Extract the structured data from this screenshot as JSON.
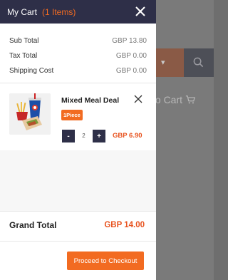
{
  "background": {
    "add_to_cart_label": "to Cart",
    "dropdown_glyph": "▾"
  },
  "cart": {
    "title": "My Cart",
    "item_count_label": "(1 Items)",
    "summary": {
      "sub_total_label": "Sub Total",
      "sub_total_value": "GBP 13.80",
      "tax_total_label": "Tax Total",
      "tax_total_value": "GBP 0.00",
      "shipping_label": "Shipping Cost",
      "shipping_value": "GBP 0.00"
    },
    "items": [
      {
        "name": "Mixed Meal Deal",
        "badge": "1Piece",
        "quantity": "2",
        "minus_label": "-",
        "plus_label": "+",
        "price": "GBP 6.90"
      }
    ],
    "grand_total_label": "Grand Total",
    "grand_total_value": "GBP 14.00",
    "checkout_label": "Proceed to Checkout"
  },
  "colors": {
    "header_bg": "#2e2f48",
    "accent": "#f26b21",
    "price": "#e8531f"
  }
}
